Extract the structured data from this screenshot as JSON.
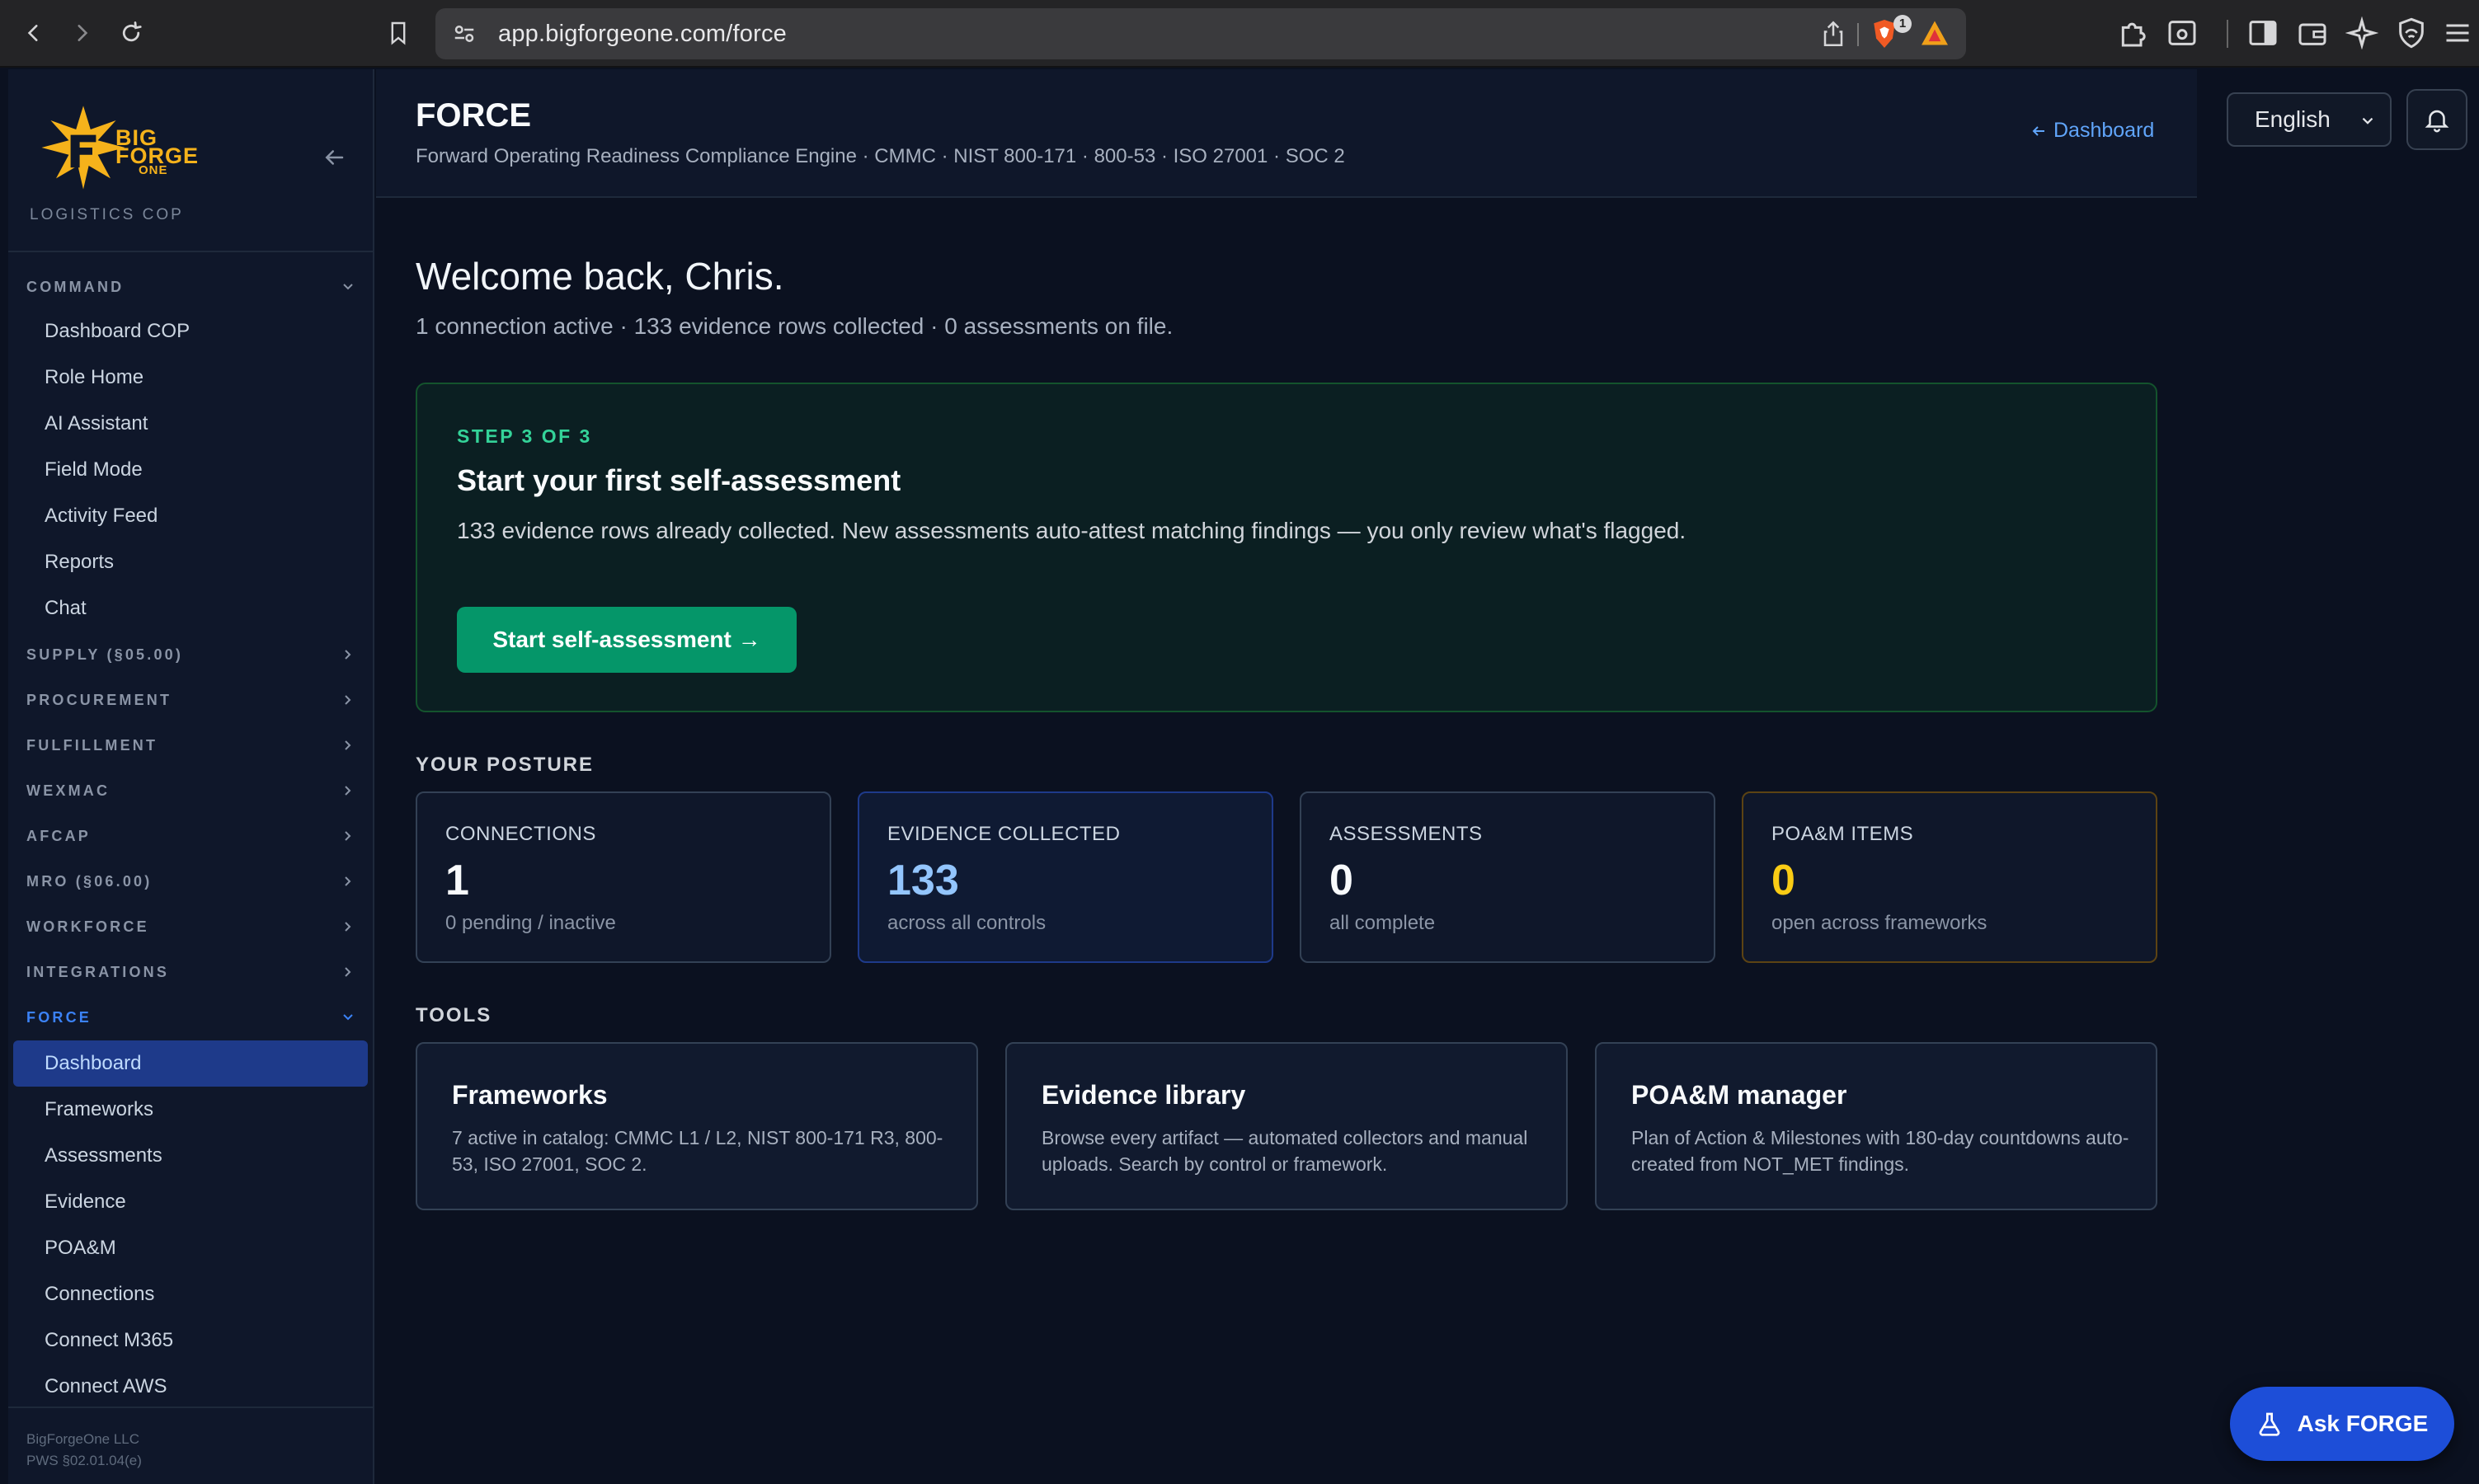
{
  "browser": {
    "url": "app.bigforgeone.com/force",
    "brave_badge": "1"
  },
  "sidebar": {
    "brand_lines": [
      "BIG",
      "FORGE",
      "ONE"
    ],
    "cop_label": "LOGISTICS COP",
    "sections": [
      {
        "label": "COMMAND",
        "expanded": true,
        "items": [
          "Dashboard COP",
          "Role Home",
          "AI Assistant",
          "Field Mode",
          "Activity Feed",
          "Reports",
          "Chat"
        ]
      },
      {
        "label": "SUPPLY (§05.00)",
        "expanded": false
      },
      {
        "label": "PROCUREMENT",
        "expanded": false
      },
      {
        "label": "FULFILLMENT",
        "expanded": false
      },
      {
        "label": "WEXMAC",
        "expanded": false
      },
      {
        "label": "AFCAP",
        "expanded": false
      },
      {
        "label": "MRO (§06.00)",
        "expanded": false
      },
      {
        "label": "WORKFORCE",
        "expanded": false
      },
      {
        "label": "INTEGRATIONS",
        "expanded": false
      },
      {
        "label": "FORCE",
        "expanded": true,
        "items": [
          "Dashboard",
          "Frameworks",
          "Assessments",
          "Evidence",
          "POA&M",
          "Connections",
          "Connect M365",
          "Connect AWS"
        ]
      }
    ],
    "active_item": "Dashboard",
    "footer": [
      "BigForgeOne LLC",
      "PWS §02.01.04(e)"
    ]
  },
  "header": {
    "title": "FORCE",
    "subtitle": "Forward Operating Readiness Compliance Engine · CMMC · NIST 800-171 · 800-53 · ISO 27001 · SOC 2",
    "back_link": "Dashboard"
  },
  "language": {
    "selected": "English"
  },
  "main": {
    "welcome": "Welcome back, Chris.",
    "welcome_sub": "1 connection active · 133 evidence rows collected · 0 assessments on file.",
    "step": {
      "label": "STEP 3 OF 3",
      "title": "Start your first self-assessment",
      "body": "133 evidence rows already collected. New assessments auto-attest matching findings — you only review what's flagged.",
      "button": "Start self-assessment →"
    },
    "posture_label": "YOUR POSTURE",
    "posture": [
      {
        "label": "CONNECTIONS",
        "value": "1",
        "sub": "0 pending / inactive"
      },
      {
        "label": "EVIDENCE COLLECTED",
        "value": "133",
        "sub": "across all controls"
      },
      {
        "label": "ASSESSMENTS",
        "value": "0",
        "sub": "all complete"
      },
      {
        "label": "POA&M ITEMS",
        "value": "0",
        "sub": "open across frameworks"
      }
    ],
    "tools_label": "TOOLS",
    "tools": [
      {
        "title": "Frameworks",
        "desc": "7 active in catalog: CMMC L1 / L2, NIST 800-171 R3, 800-53, ISO 27001, SOC 2."
      },
      {
        "title": "Evidence library",
        "desc": "Browse every artifact — automated collectors and manual uploads. Search by control or framework."
      },
      {
        "title": "POA&M manager",
        "desc": "Plan of Action & Milestones with 180-day countdowns auto-created from NOT_MET findings."
      }
    ]
  },
  "ask_button": "Ask FORGE",
  "colors": {
    "accent": "#3b82f6",
    "success": "#059669",
    "warning": "#facc15",
    "brand": "#f5b21b"
  }
}
